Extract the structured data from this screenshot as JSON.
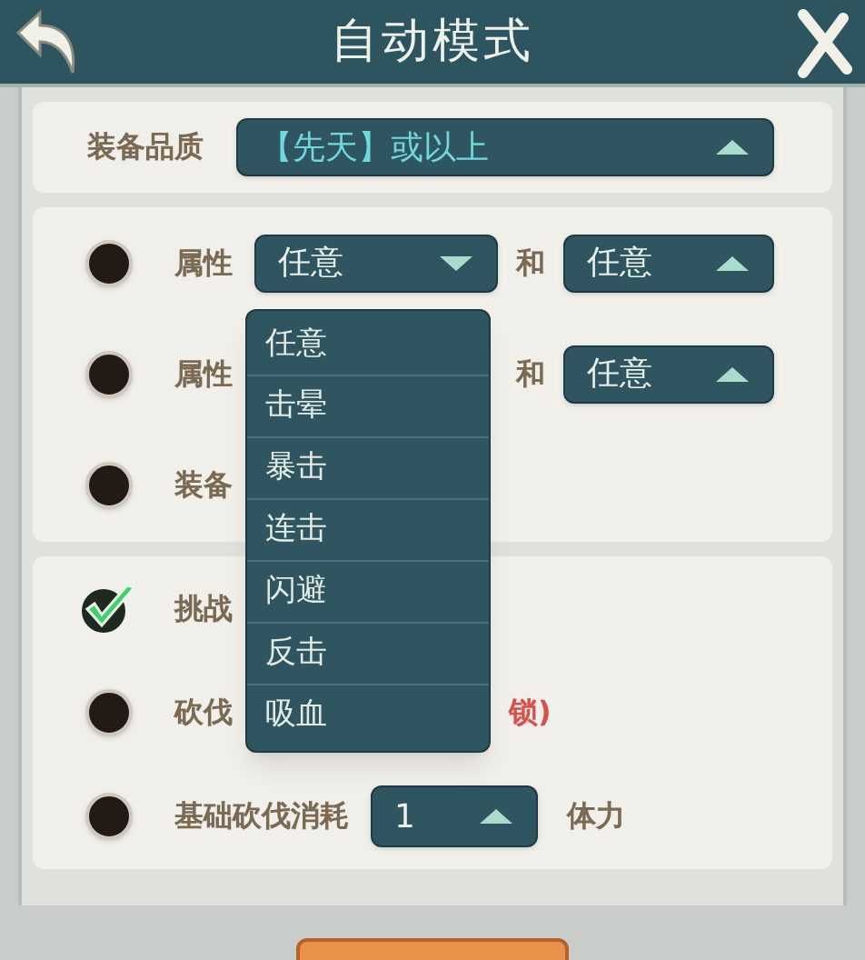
{
  "header": {
    "title": "自动模式"
  },
  "quality": {
    "label": "装备品质",
    "value": "【先天】或以上",
    "open": false
  },
  "filters": [
    {
      "kind": "attribute",
      "checked": false,
      "label": "属性",
      "select_a": {
        "value": "任意",
        "open": true
      },
      "joiner": "和",
      "select_b": {
        "value": "任意",
        "open": false
      }
    },
    {
      "kind": "attribute",
      "checked": false,
      "label": "属性",
      "joiner": "和",
      "select_b": {
        "value": "任意",
        "open": false
      }
    },
    {
      "kind": "text",
      "checked": false,
      "label": "装备"
    }
  ],
  "options": [
    {
      "kind": "text",
      "checked": true,
      "label": "挑战"
    },
    {
      "kind": "locked",
      "checked": false,
      "label": "砍伐",
      "note": "锁)"
    },
    {
      "kind": "cost",
      "checked": false,
      "label": "基础砍伐消耗",
      "value": "1",
      "open": false,
      "unit": "体力"
    }
  ],
  "dropdown": [
    "任意",
    "击晕",
    "暴击",
    "连击",
    "闪避",
    "反击",
    "吸血"
  ]
}
